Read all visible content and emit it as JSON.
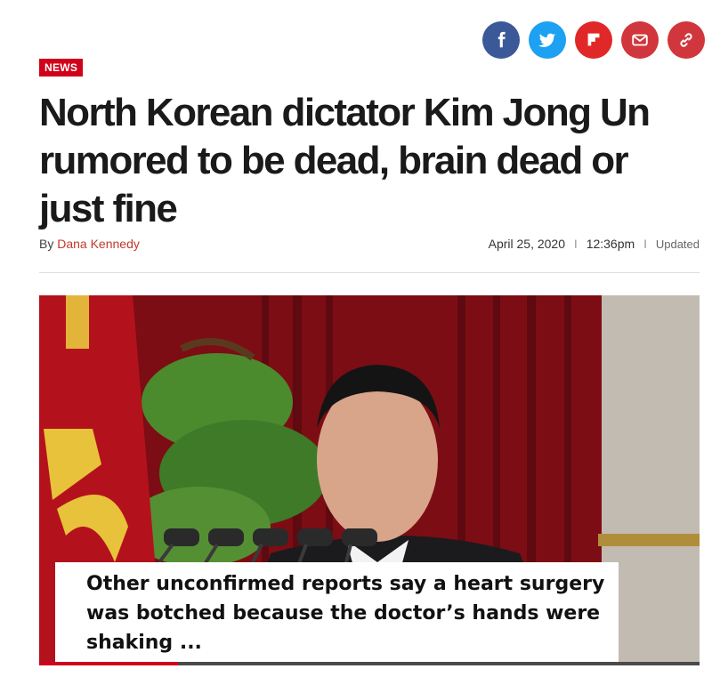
{
  "share": [
    {
      "name": "facebook",
      "icon": "facebook-icon",
      "color": "#3b5998"
    },
    {
      "name": "twitter",
      "icon": "twitter-icon",
      "color": "#1da1f2"
    },
    {
      "name": "flipboard",
      "icon": "flipboard-icon",
      "color": "#e12828"
    },
    {
      "name": "email",
      "icon": "email-icon",
      "color": "#d0363b"
    },
    {
      "name": "copy-link",
      "icon": "link-icon",
      "color": "#d0363b"
    }
  ],
  "article": {
    "section": "NEWS",
    "headline": "North Korean dictator Kim Jong Un rumored to be dead, brain dead or just fine",
    "byline_prefix": "By",
    "author": "Dana Kennedy",
    "date": "April 25, 2020",
    "time": "12:36pm",
    "updated_label": "Updated",
    "separator": "I"
  },
  "media": {
    "caption": "Other unconfirmed reports say a heart surgery was botched because the doctor’s hands were shaking ...",
    "progress": 0.21
  },
  "colors": {
    "accent": "#d0021b",
    "author_link": "#c0392b"
  }
}
